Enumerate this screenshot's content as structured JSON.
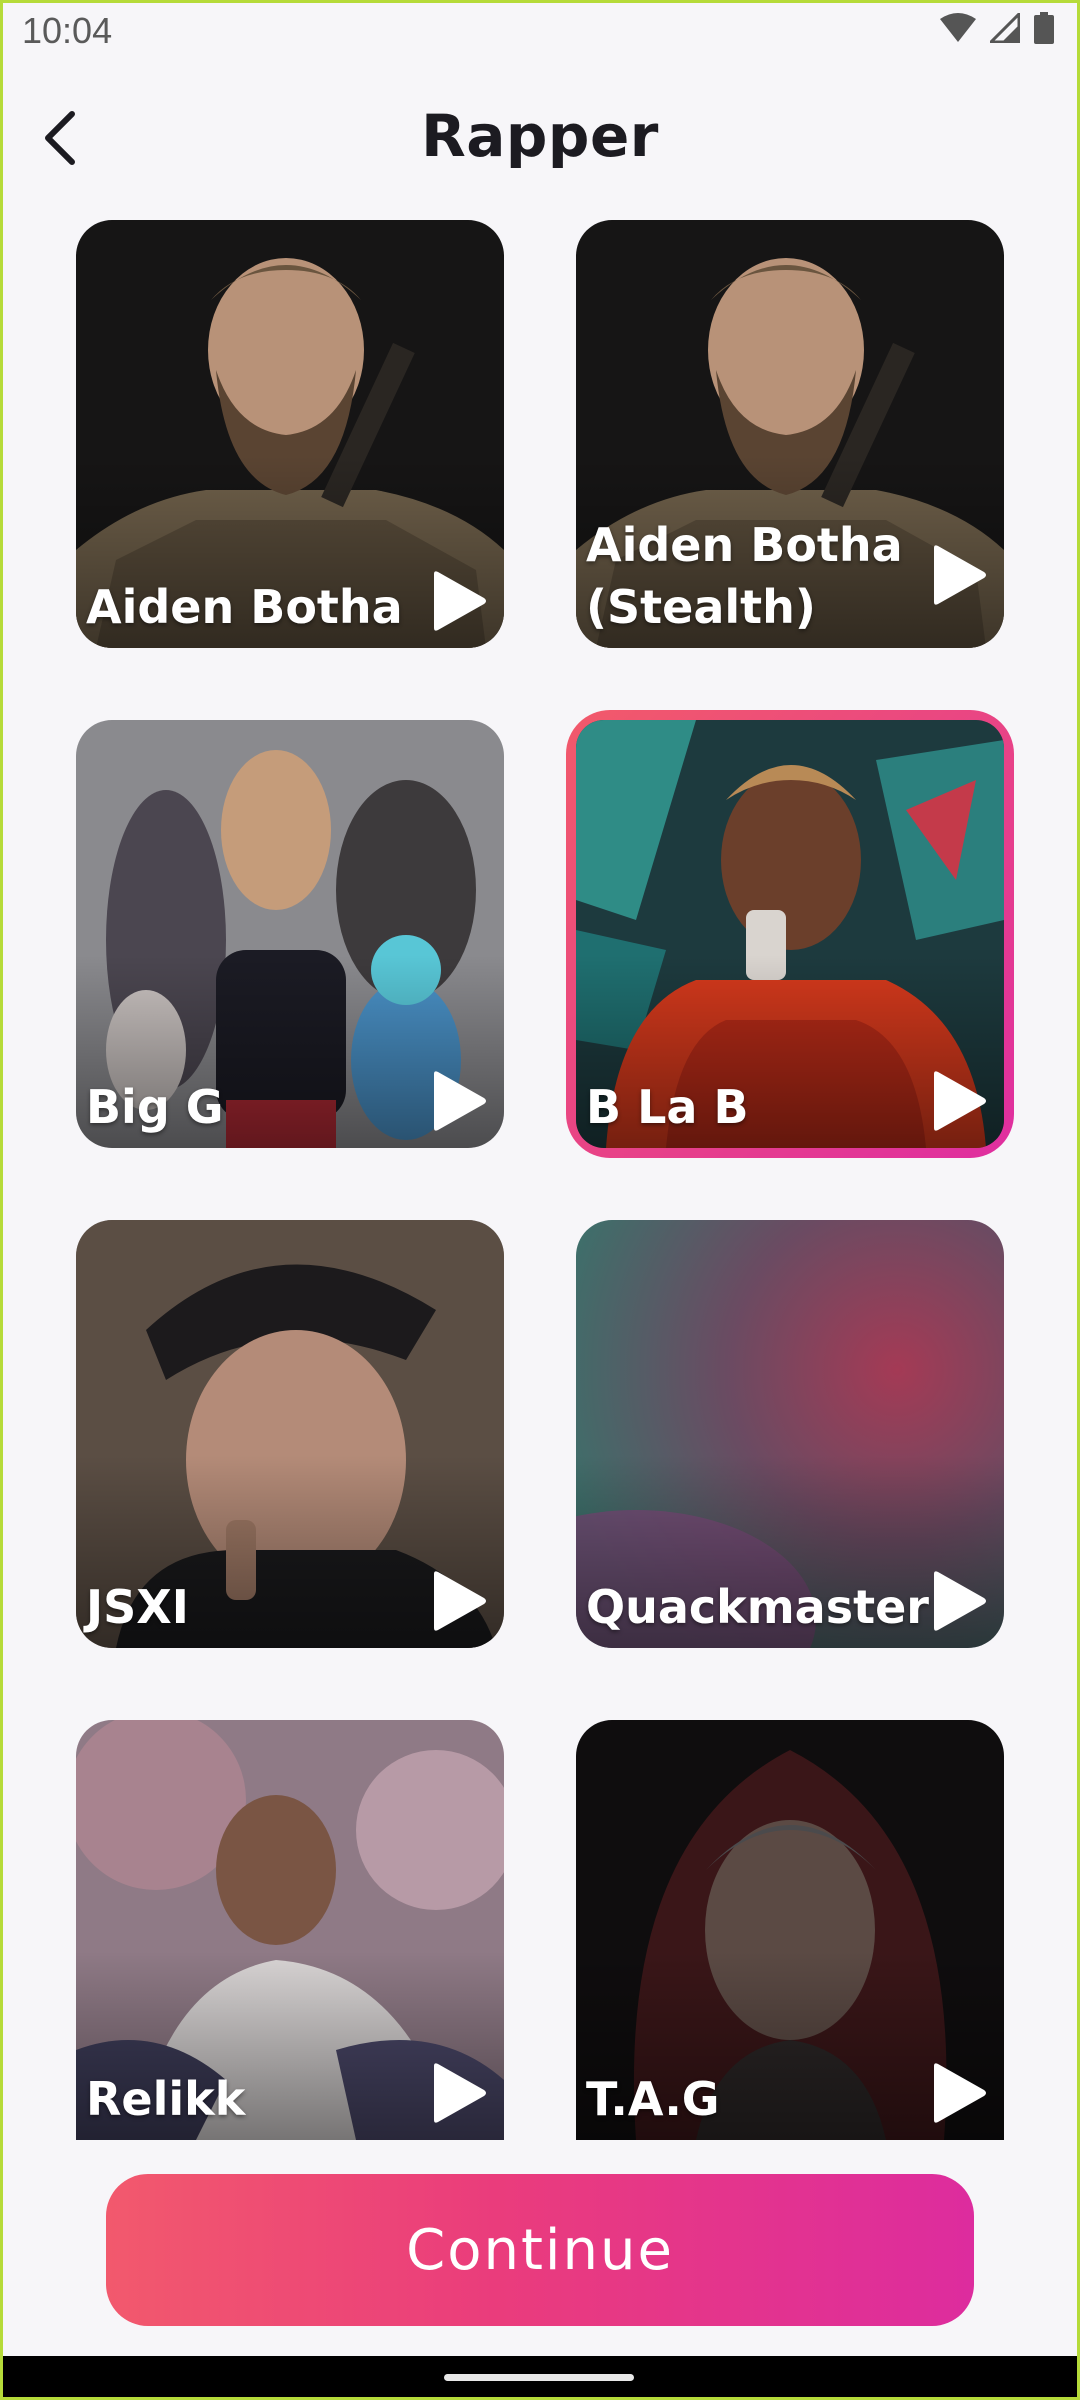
{
  "status_bar": {
    "time": "10:04"
  },
  "header": {
    "title": "Rapper"
  },
  "voices": [
    {
      "name": "Aiden Botha"
    },
    {
      "name": "Aiden Botha (Stealth)"
    },
    {
      "name": "Big G"
    },
    {
      "name": "B La B",
      "selected": true
    },
    {
      "name": "JSXI"
    },
    {
      "name": "Quackmaster"
    },
    {
      "name": "Relikk"
    },
    {
      "name": "T.A.G"
    }
  ],
  "continue_label": "Continue",
  "colors": {
    "accent_start": "#f2596d",
    "accent_end": "#dd2c9e",
    "background": "#f7f6f9"
  }
}
